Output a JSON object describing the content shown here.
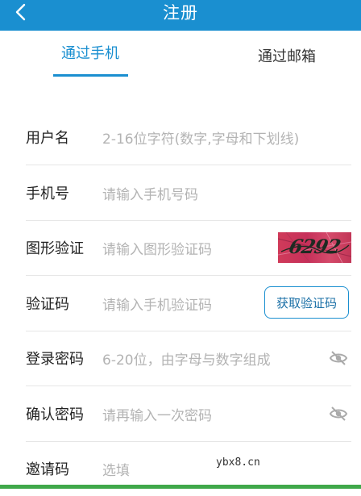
{
  "header": {
    "title": "注册",
    "back_icon": "chevron-left-icon"
  },
  "tabs": [
    {
      "label": "通过手机",
      "active": true
    },
    {
      "label": "通过邮箱",
      "active": false
    }
  ],
  "form": {
    "username": {
      "label": "用户名",
      "placeholder": "2-16位字符(数字,字母和下划线)"
    },
    "phone": {
      "label": "手机号",
      "placeholder": "请输入手机号码"
    },
    "captcha": {
      "label": "图形验证",
      "placeholder": "请输入图形验证码",
      "image_text": "6292"
    },
    "sms_code": {
      "label": "验证码",
      "placeholder": "请输入手机验证码",
      "button": "获取验证码"
    },
    "password": {
      "label": "登录密码",
      "placeholder": "6-20位，由字母与数字组成",
      "toggle_icon": "eye-slash-icon"
    },
    "confirm_password": {
      "label": "确认密码",
      "placeholder": "请再输入一次密码",
      "toggle_icon": "eye-slash-icon"
    },
    "invite_code": {
      "label": "邀请码",
      "placeholder": "选填"
    }
  },
  "watermark": "ybx8.cn",
  "colors": {
    "accent": "#1a8fd0",
    "placeholder": "#b3b3b3",
    "bottom_bar": "#3fa84a"
  }
}
